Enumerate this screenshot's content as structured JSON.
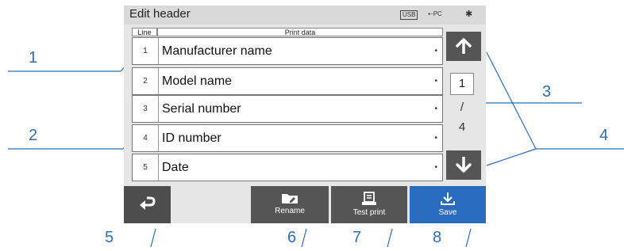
{
  "header": {
    "title": "Edit header",
    "status": {
      "usb": "USB",
      "pc": "PC",
      "bluetooth": "✱"
    }
  },
  "table": {
    "col_line": "Line",
    "col_data": "Print data",
    "rows": [
      {
        "line": "1",
        "name": "Manufacturer name"
      },
      {
        "line": "2",
        "name": "Model name"
      },
      {
        "line": "3",
        "name": "Serial number"
      },
      {
        "line": "4",
        "name": "ID number"
      },
      {
        "line": "5",
        "name": "Date"
      }
    ],
    "row_marker": "•"
  },
  "pager": {
    "current": "1",
    "separator": "/",
    "total": "4"
  },
  "footer": {
    "rename_label": "Rename",
    "test_print_label": "Test print",
    "save_label": "Save"
  },
  "callouts": [
    "1",
    "2",
    "3",
    "4",
    "5",
    "6",
    "7",
    "8"
  ],
  "colors": {
    "accent": "#2e6db4",
    "save": "#2a6cc0",
    "button": "#555555"
  }
}
